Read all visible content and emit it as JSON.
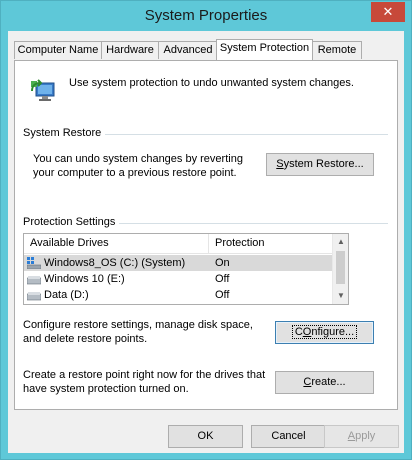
{
  "window": {
    "title": "System Properties",
    "close_label": "✕"
  },
  "tabs": [
    {
      "label": "Computer Name",
      "active": false
    },
    {
      "label": "Hardware",
      "active": false
    },
    {
      "label": "Advanced",
      "active": false
    },
    {
      "label": "System Protection",
      "active": true
    },
    {
      "label": "Remote",
      "active": false
    }
  ],
  "intro": {
    "icon": "system-protection-icon",
    "text": "Use system protection to undo unwanted system changes."
  },
  "system_restore": {
    "group_title": "System Restore",
    "description_line1": "You can undo system changes by reverting",
    "description_line2": "your computer to a previous restore point.",
    "button_mnemonic": "S",
    "button_rest": "ystem Restore..."
  },
  "protection_settings": {
    "group_title": "Protection Settings",
    "columns": [
      "Available Drives",
      "Protection"
    ],
    "drives": [
      {
        "name": "Windows8_OS (C:) (System)",
        "protection": "On",
        "icon": "system-drive-icon",
        "selected": true
      },
      {
        "name": "Windows 10 (E:)",
        "protection": "Off",
        "icon": "hard-drive-icon",
        "selected": false
      },
      {
        "name": "Data (D:)",
        "protection": "Off",
        "icon": "hard-drive-icon",
        "selected": false
      }
    ],
    "configure_line1": "Configure restore settings, manage disk space,",
    "configure_line2": "and delete restore points.",
    "configure_button_mnemonic": "O",
    "configure_button_rest": "nfigure...",
    "configure_button_prefix": "C",
    "create_line1": "Create a restore point right now for the drives that",
    "create_line2": "have system protection turned on.",
    "create_button_prefix": "",
    "create_button_mnemonic": "C",
    "create_button_rest": "reate..."
  },
  "footer": {
    "ok_label": "OK",
    "cancel_label": "Cancel",
    "apply_mnemonic": "A",
    "apply_rest": "pply"
  },
  "colors": {
    "title_bar": "#5ec8d8",
    "close_button": "#c7493a",
    "selection": "#d9d9d9"
  }
}
